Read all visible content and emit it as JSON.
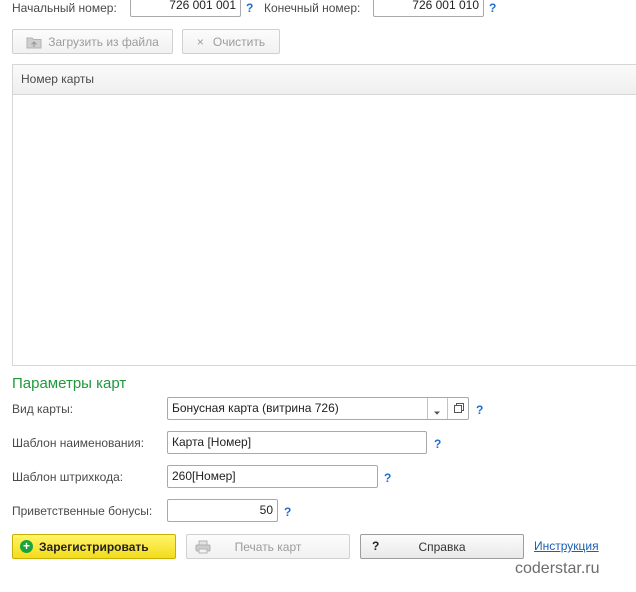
{
  "range": {
    "start_label": "Начальный номер:",
    "start_value": "726 001 001",
    "end_label": "Конечный номер:",
    "end_value": "726 001 010",
    "help": "?"
  },
  "toolbar": {
    "load_label": "Загрузить из файла",
    "clear_label": "Очистить",
    "clear_icon": "×"
  },
  "table": {
    "column_header": "Номер карты",
    "rows": []
  },
  "params": {
    "title": "Параметры карт",
    "card_type_label": "Вид карты:",
    "card_type_value": "Бонусная карта (витрина 726)",
    "name_template_label": "Шаблон наименования:",
    "name_template_value": "Карта [Номер]",
    "barcode_template_label": "Шаблон штрихкода:",
    "barcode_template_value": "260[Номер]",
    "welcome_bonus_label": "Приветственные бонусы:",
    "welcome_bonus_value": "50",
    "help": "?"
  },
  "actions": {
    "register_label": "Зарегистрировать",
    "register_icon": "+",
    "print_label": "Печать карт",
    "help_button_label": "Справка",
    "help_button_icon": "?",
    "instruction_link": "Инструкция"
  },
  "watermark": "coderstar.ru",
  "colors": {
    "section_title": "#1e9a3c",
    "register_button": "#f3dc1b",
    "help_mark": "#1f6fd1",
    "link": "#1b5fb3"
  }
}
